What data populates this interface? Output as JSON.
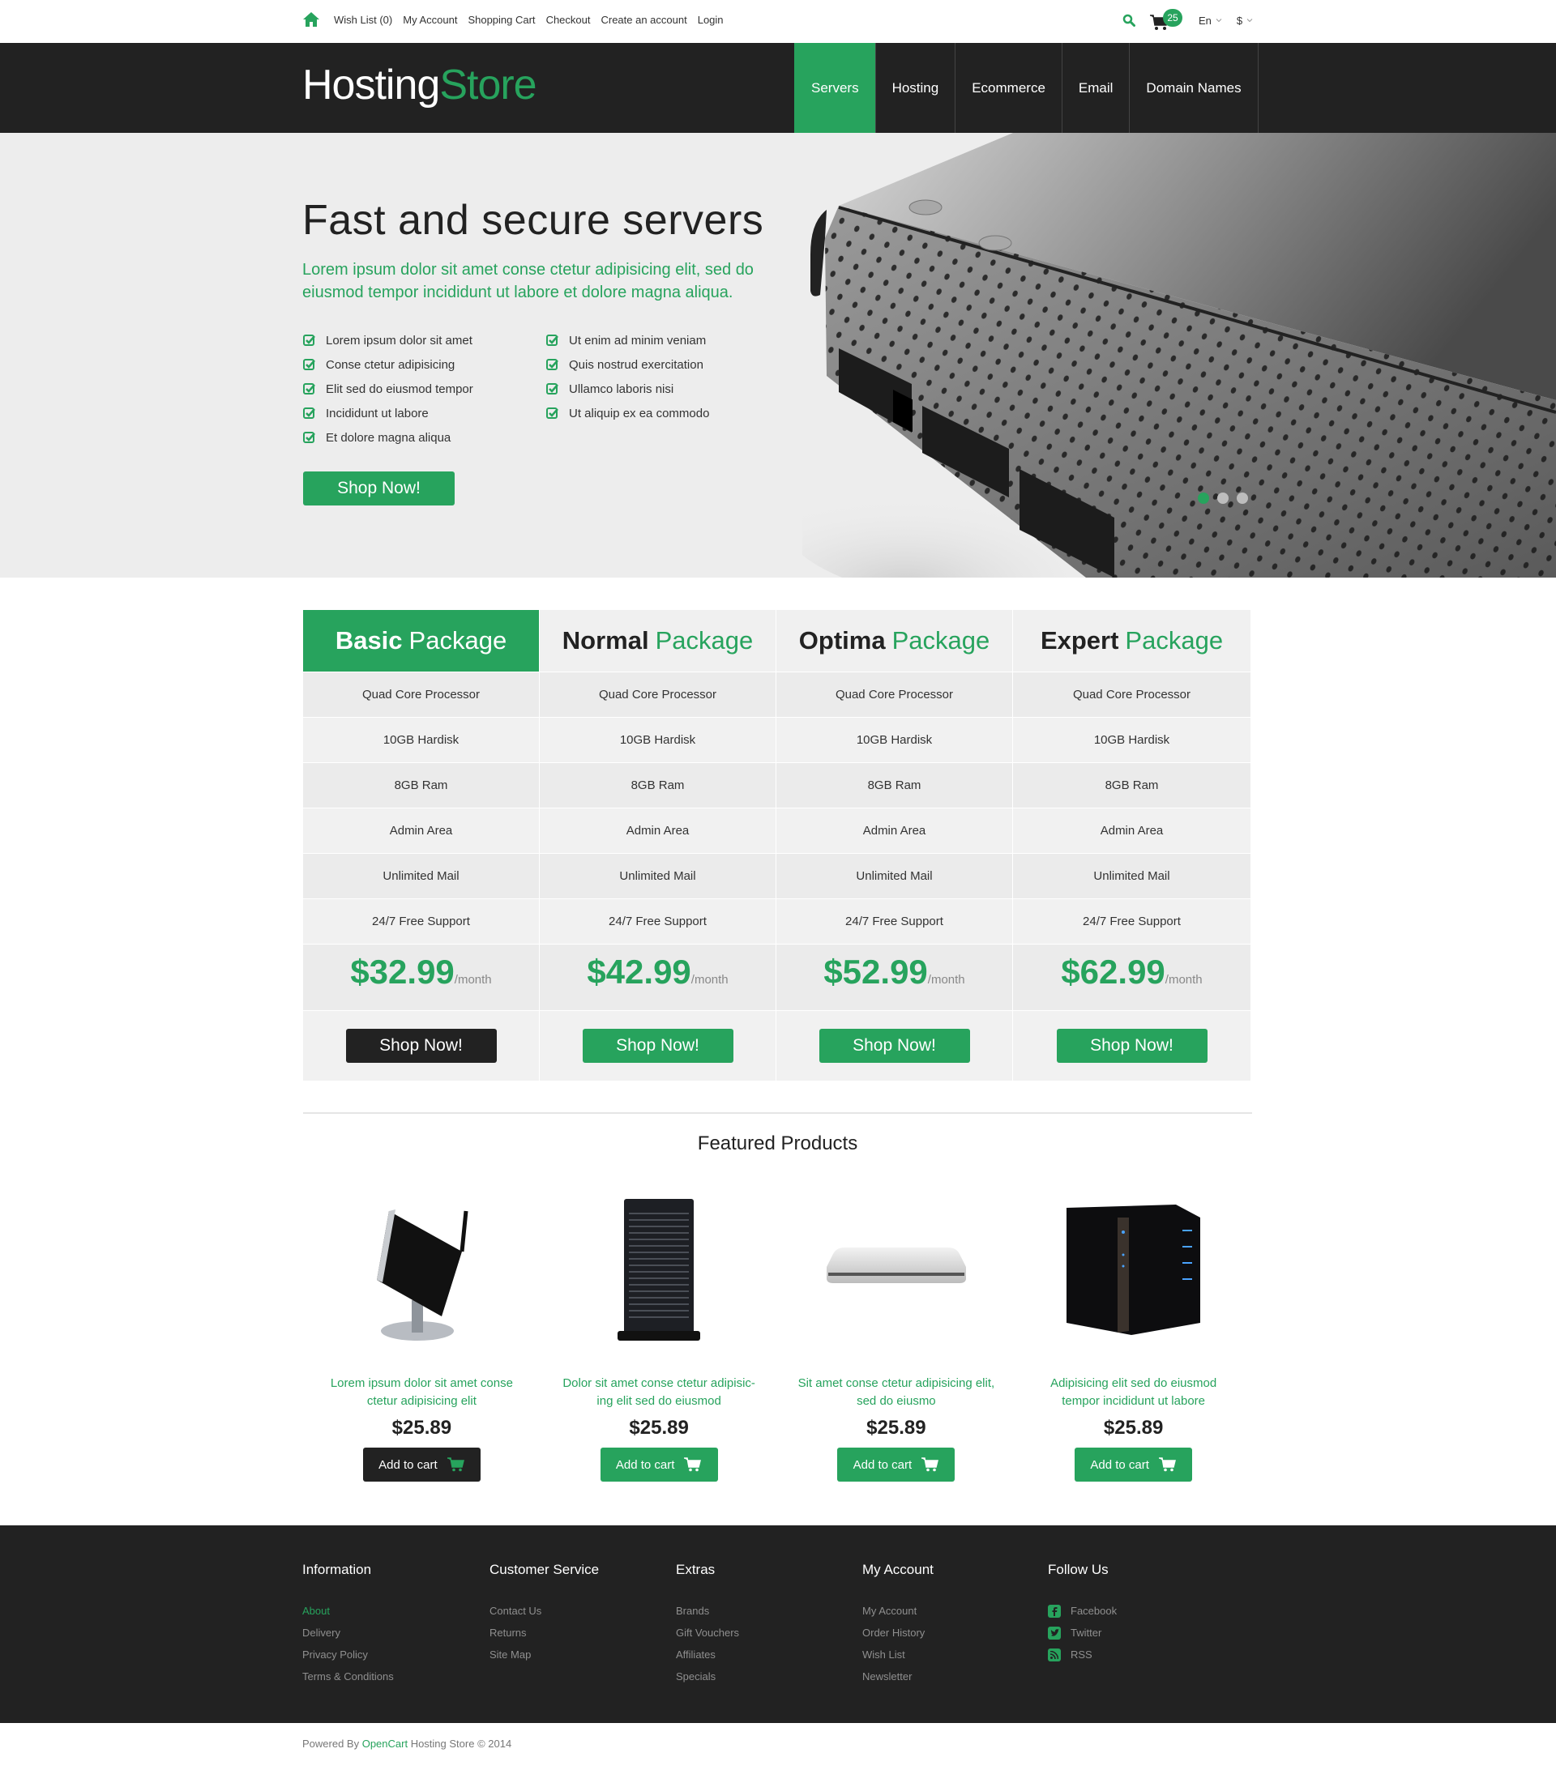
{
  "topbar": {
    "links": [
      "Wish List (0)",
      "My Account",
      "Shopping Cart",
      "Checkout",
      "Create an account",
      "Login"
    ],
    "cart_count": "25",
    "language": "En",
    "currency": "$"
  },
  "header": {
    "logo_part1": "Hosting",
    "logo_part2": "Store",
    "nav": [
      {
        "label": "Servers",
        "active": true
      },
      {
        "label": "Hosting",
        "active": false
      },
      {
        "label": "Ecommerce",
        "active": false
      },
      {
        "label": "Email",
        "active": false
      },
      {
        "label": "Domain Names",
        "active": false
      }
    ]
  },
  "hero": {
    "title": "Fast and secure servers",
    "subtitle": "Lorem ipsum dolor sit amet conse ctetur adipisicing elit, sed do eiusmod tempor incididunt ut labore et dolore magna aliqua.",
    "list_left": [
      "Lorem ipsum dolor sit amet",
      "Conse ctetur adipisicing",
      "Elit sed do eiusmod tempor",
      "Incididunt ut labore",
      "Et dolore magna aliqua"
    ],
    "list_right": [
      "Ut enim ad minim veniam",
      "Quis nostrud exercitation",
      "Ullamco laboris nisi",
      "Ut aliquip ex ea commodo"
    ],
    "button": "Shop Now!",
    "slides": 3,
    "active_slide": 1
  },
  "pricing": {
    "packages": [
      {
        "name": "Basic",
        "suffix": "Package",
        "price": "$32.99",
        "period": "/month",
        "button": "Shop Now!",
        "featured": true
      },
      {
        "name": "Normal",
        "suffix": "Package",
        "price": "$42.99",
        "period": "/month",
        "button": "Shop Now!",
        "featured": false
      },
      {
        "name": "Optima",
        "suffix": "Package",
        "price": "$52.99",
        "period": "/month",
        "button": "Shop Now!",
        "featured": false
      },
      {
        "name": "Expert",
        "suffix": "Package",
        "price": "$62.99",
        "period": "/month",
        "button": "Shop Now!",
        "featured": false
      }
    ],
    "features": [
      "Quad Core Processor",
      "10GB Hardisk",
      "8GB Ram",
      "Admin Area",
      "Unlimited Mail",
      "24/7 Free Support"
    ]
  },
  "featured": {
    "title": "Featured Products",
    "products": [
      {
        "name": "Lorem ipsum dolor sit amet conse ctetur adipisicing elit",
        "price": "$25.89",
        "button": "Add to cart",
        "image": "mini-pc"
      },
      {
        "name": "Dolor sit amet conse ctetur adipisic-ing elit sed do eiusmod",
        "price": "$25.89",
        "button": "Add to cart",
        "image": "tower-server"
      },
      {
        "name": "Sit amet conse ctetur adipisicing elit, sed do eiusmo",
        "price": "$25.89",
        "button": "Add to cart",
        "image": "external-drive"
      },
      {
        "name": "Adipisicing elit sed do eiusmod tempor incididunt ut labore",
        "price": "$25.89",
        "button": "Add to cart",
        "image": "nas-cube"
      }
    ]
  },
  "footer": {
    "columns": [
      {
        "title": "Information",
        "links": [
          "About",
          "Delivery",
          "Privacy Policy",
          "Terms & Conditions"
        ]
      },
      {
        "title": "Customer Service",
        "links": [
          "Contact Us",
          "Returns",
          "Site Map"
        ]
      },
      {
        "title": "Extras",
        "links": [
          "Brands",
          "Gift Vouchers",
          "Affiliates",
          "Specials"
        ]
      },
      {
        "title": "My Account",
        "links": [
          "My Account",
          "Order History",
          "Wish List",
          "Newsletter"
        ]
      }
    ],
    "follow": {
      "title": "Follow Us",
      "links": [
        {
          "label": "Facebook",
          "icon": "facebook-icon"
        },
        {
          "label": "Twitter",
          "icon": "twitter-icon"
        },
        {
          "label": "RSS",
          "icon": "rss-icon"
        }
      ]
    },
    "powered_prefix": "Powered By ",
    "powered_link": "OpenCart",
    "powered_suffix": " Hosting Store © 2014"
  },
  "colors": {
    "accent": "#27a35d",
    "dark": "#222222",
    "hero_bg": "#ededed"
  }
}
